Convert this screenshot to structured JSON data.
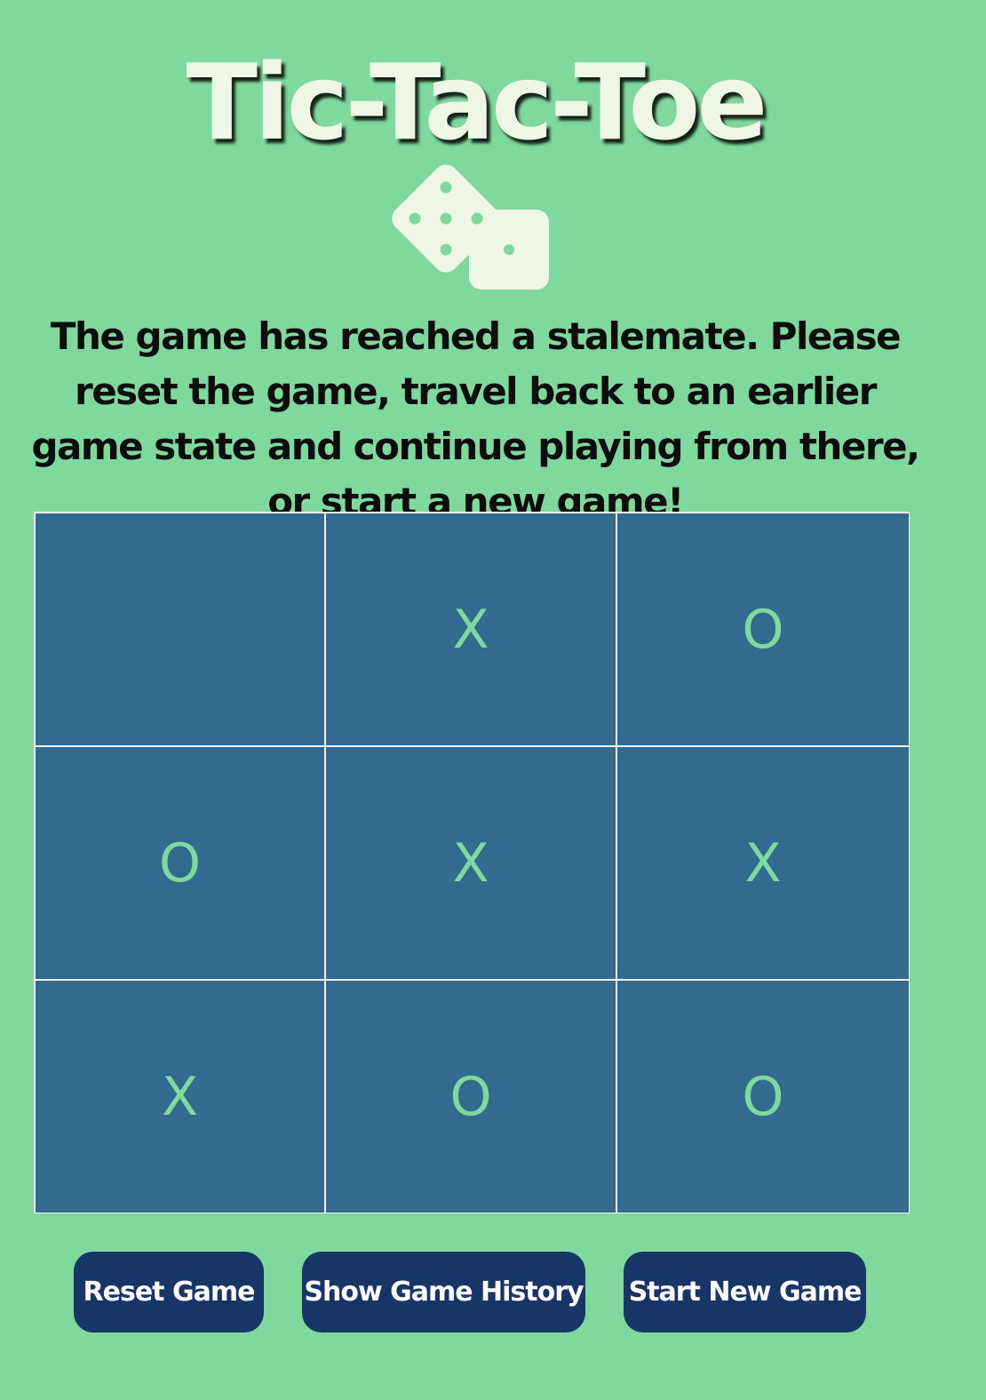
{
  "title": "Tic-Tac-Toe",
  "icon": "dice-icon",
  "message": "The game has reached a stalemate. Please reset the game, travel back to an earlier game state and continue playing from there, or start a new game!",
  "board": {
    "cells": [
      "",
      "X",
      "O",
      "O",
      "X",
      "X",
      "X",
      "O",
      "O"
    ]
  },
  "buttons": {
    "reset": "Reset Game",
    "history": "Show Game History",
    "new_game": "Start New Game"
  },
  "colors": {
    "background": "#7fd99c",
    "board": "#326b8f",
    "mark": "#7fd99c",
    "button": "#173566",
    "title": "#f0f6e6"
  }
}
